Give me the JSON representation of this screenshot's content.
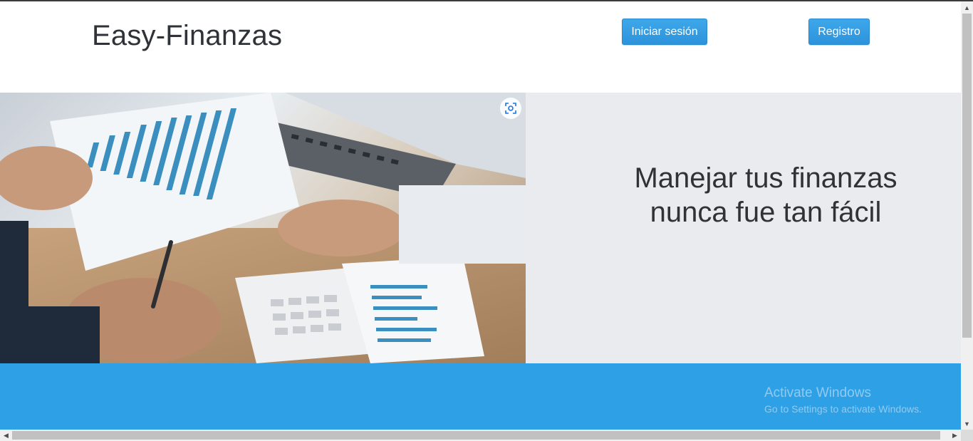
{
  "header": {
    "brand": "Easy-Finanzas",
    "login_label": "Iniciar sesión",
    "register_label": "Registro"
  },
  "hero": {
    "headline_line1": "Manejar tus finanzas",
    "headline_line2": "nunca fue tan fácil",
    "lens_icon": "visual-search-icon"
  },
  "watermark": {
    "title": "Activate Windows",
    "subtitle": "Go to Settings to activate Windows."
  },
  "colors": {
    "accent": "#2ea1e6",
    "hero_bg": "#e9ebee",
    "text": "#2f3237"
  }
}
